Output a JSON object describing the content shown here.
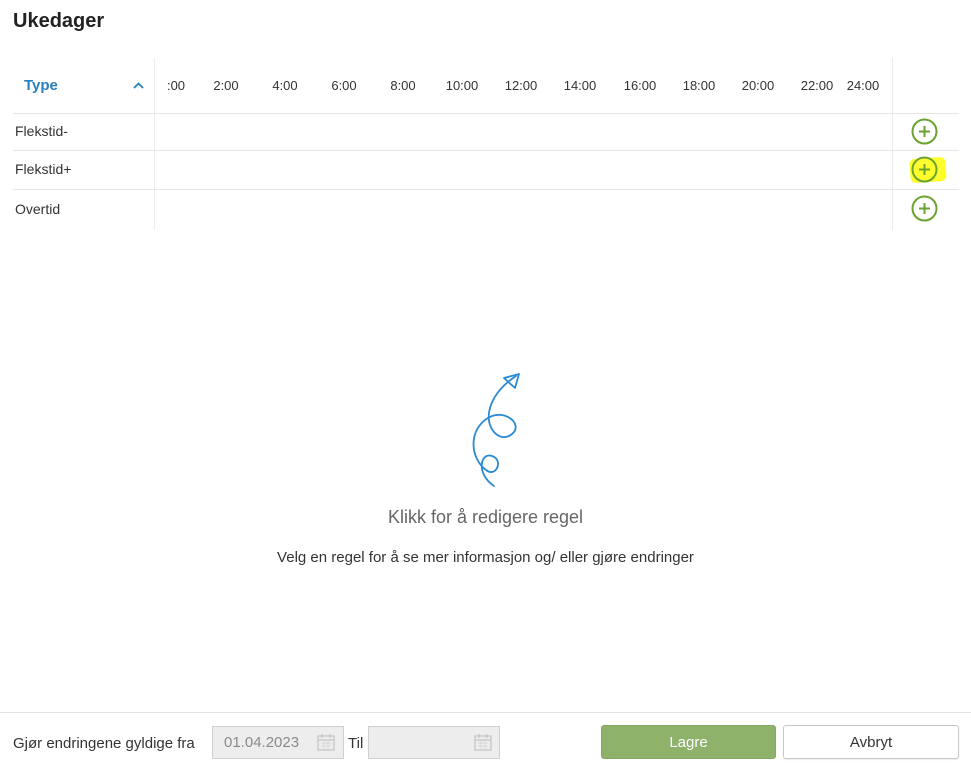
{
  "page": {
    "title": "Ukedager"
  },
  "timeline": {
    "type_header": "Type",
    "sort_icon": "chevron-up-icon",
    "hours": [
      ":00",
      "2:00",
      "4:00",
      "6:00",
      "8:00",
      "10:00",
      "12:00",
      "14:00",
      "16:00",
      "18:00",
      "20:00",
      "22:00",
      "24:00"
    ],
    "rows": [
      {
        "label": "Flekstid-",
        "add_icon": "plus-circle-icon"
      },
      {
        "label": "Flekstid+",
        "add_icon": "plus-circle-icon",
        "highlighted": true
      },
      {
        "label": "Overtid",
        "add_icon": "plus-circle-icon"
      }
    ]
  },
  "empty_state": {
    "icon": "curly-arrow-icon",
    "title": "Klikk for å redigere regel",
    "subtitle": "Velg en regel for å se mer informasjon og/ eller gjøre endringer"
  },
  "footer": {
    "valid_from_label": "Gjør endringene gyldige fra",
    "valid_from_value": "01.04.2023",
    "to_label": "Til",
    "to_value": "",
    "calendar_icon": "calendar-icon",
    "save_label": "Lagre",
    "cancel_label": "Avbryt"
  },
  "colors": {
    "accent": "#2a7fbd",
    "add_green": "#6aa32f",
    "save_green": "#8fb26b",
    "highlight": "#ffff2e",
    "doodle_blue": "#2a8ad4"
  }
}
